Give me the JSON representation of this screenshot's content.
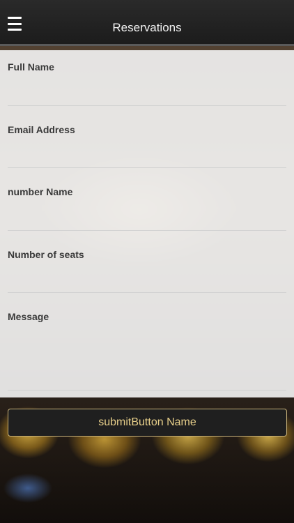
{
  "header": {
    "title": "Reservations",
    "menu_icon": "hamburger-menu-icon"
  },
  "form": {
    "fields": [
      {
        "label": "Full Name",
        "value": ""
      },
      {
        "label": "Email Address",
        "value": ""
      },
      {
        "label": "number Name",
        "value": ""
      },
      {
        "label": "Number of seats",
        "value": ""
      },
      {
        "label": "Message",
        "value": ""
      }
    ]
  },
  "submit": {
    "label": "submitButton Name"
  },
  "colors": {
    "header_bg": "#1c1c1c",
    "button_text": "#e7cf8a",
    "button_border": "#c8b27a"
  }
}
